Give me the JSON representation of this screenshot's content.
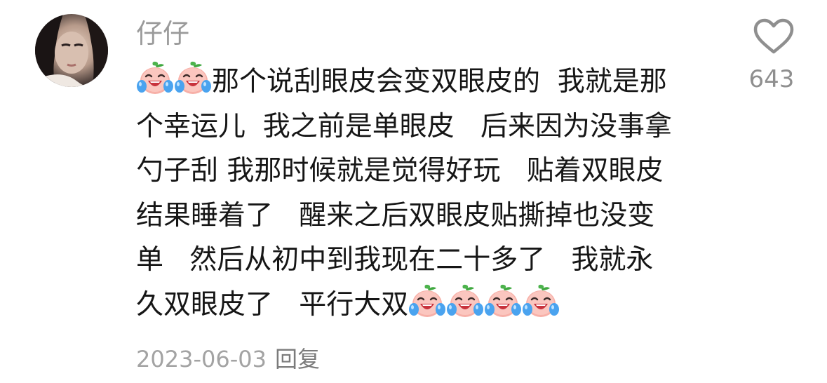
{
  "comment": {
    "username": "仔仔",
    "avatar_icon": "user-avatar",
    "emoji_icon": "crying-laughing-peach-emoji",
    "lines": [
      {
        "pre_emoji": 2,
        "text": "那个说刮眼皮会变双眼皮的  我就是那",
        "post_emoji": 0
      },
      {
        "pre_emoji": 0,
        "text": "个幸运儿  我之前是单眼皮   后来因为没事拿",
        "post_emoji": 0
      },
      {
        "pre_emoji": 0,
        "text": "勺子刮 我那时候就是觉得好玩   贴着双眼皮",
        "post_emoji": 0
      },
      {
        "pre_emoji": 0,
        "text": "结果睡着了   醒来之后双眼皮贴撕掉也没变",
        "post_emoji": 0
      },
      {
        "pre_emoji": 0,
        "text": "单   然后从初中到我现在二十多了   我就永",
        "post_emoji": 0
      },
      {
        "pre_emoji": 0,
        "text": "久双眼皮了   平行大双",
        "post_emoji": 4
      }
    ],
    "date": "2023-06-03",
    "reply_label": "回复",
    "like_icon": "heart-icon",
    "like_count": "643"
  }
}
